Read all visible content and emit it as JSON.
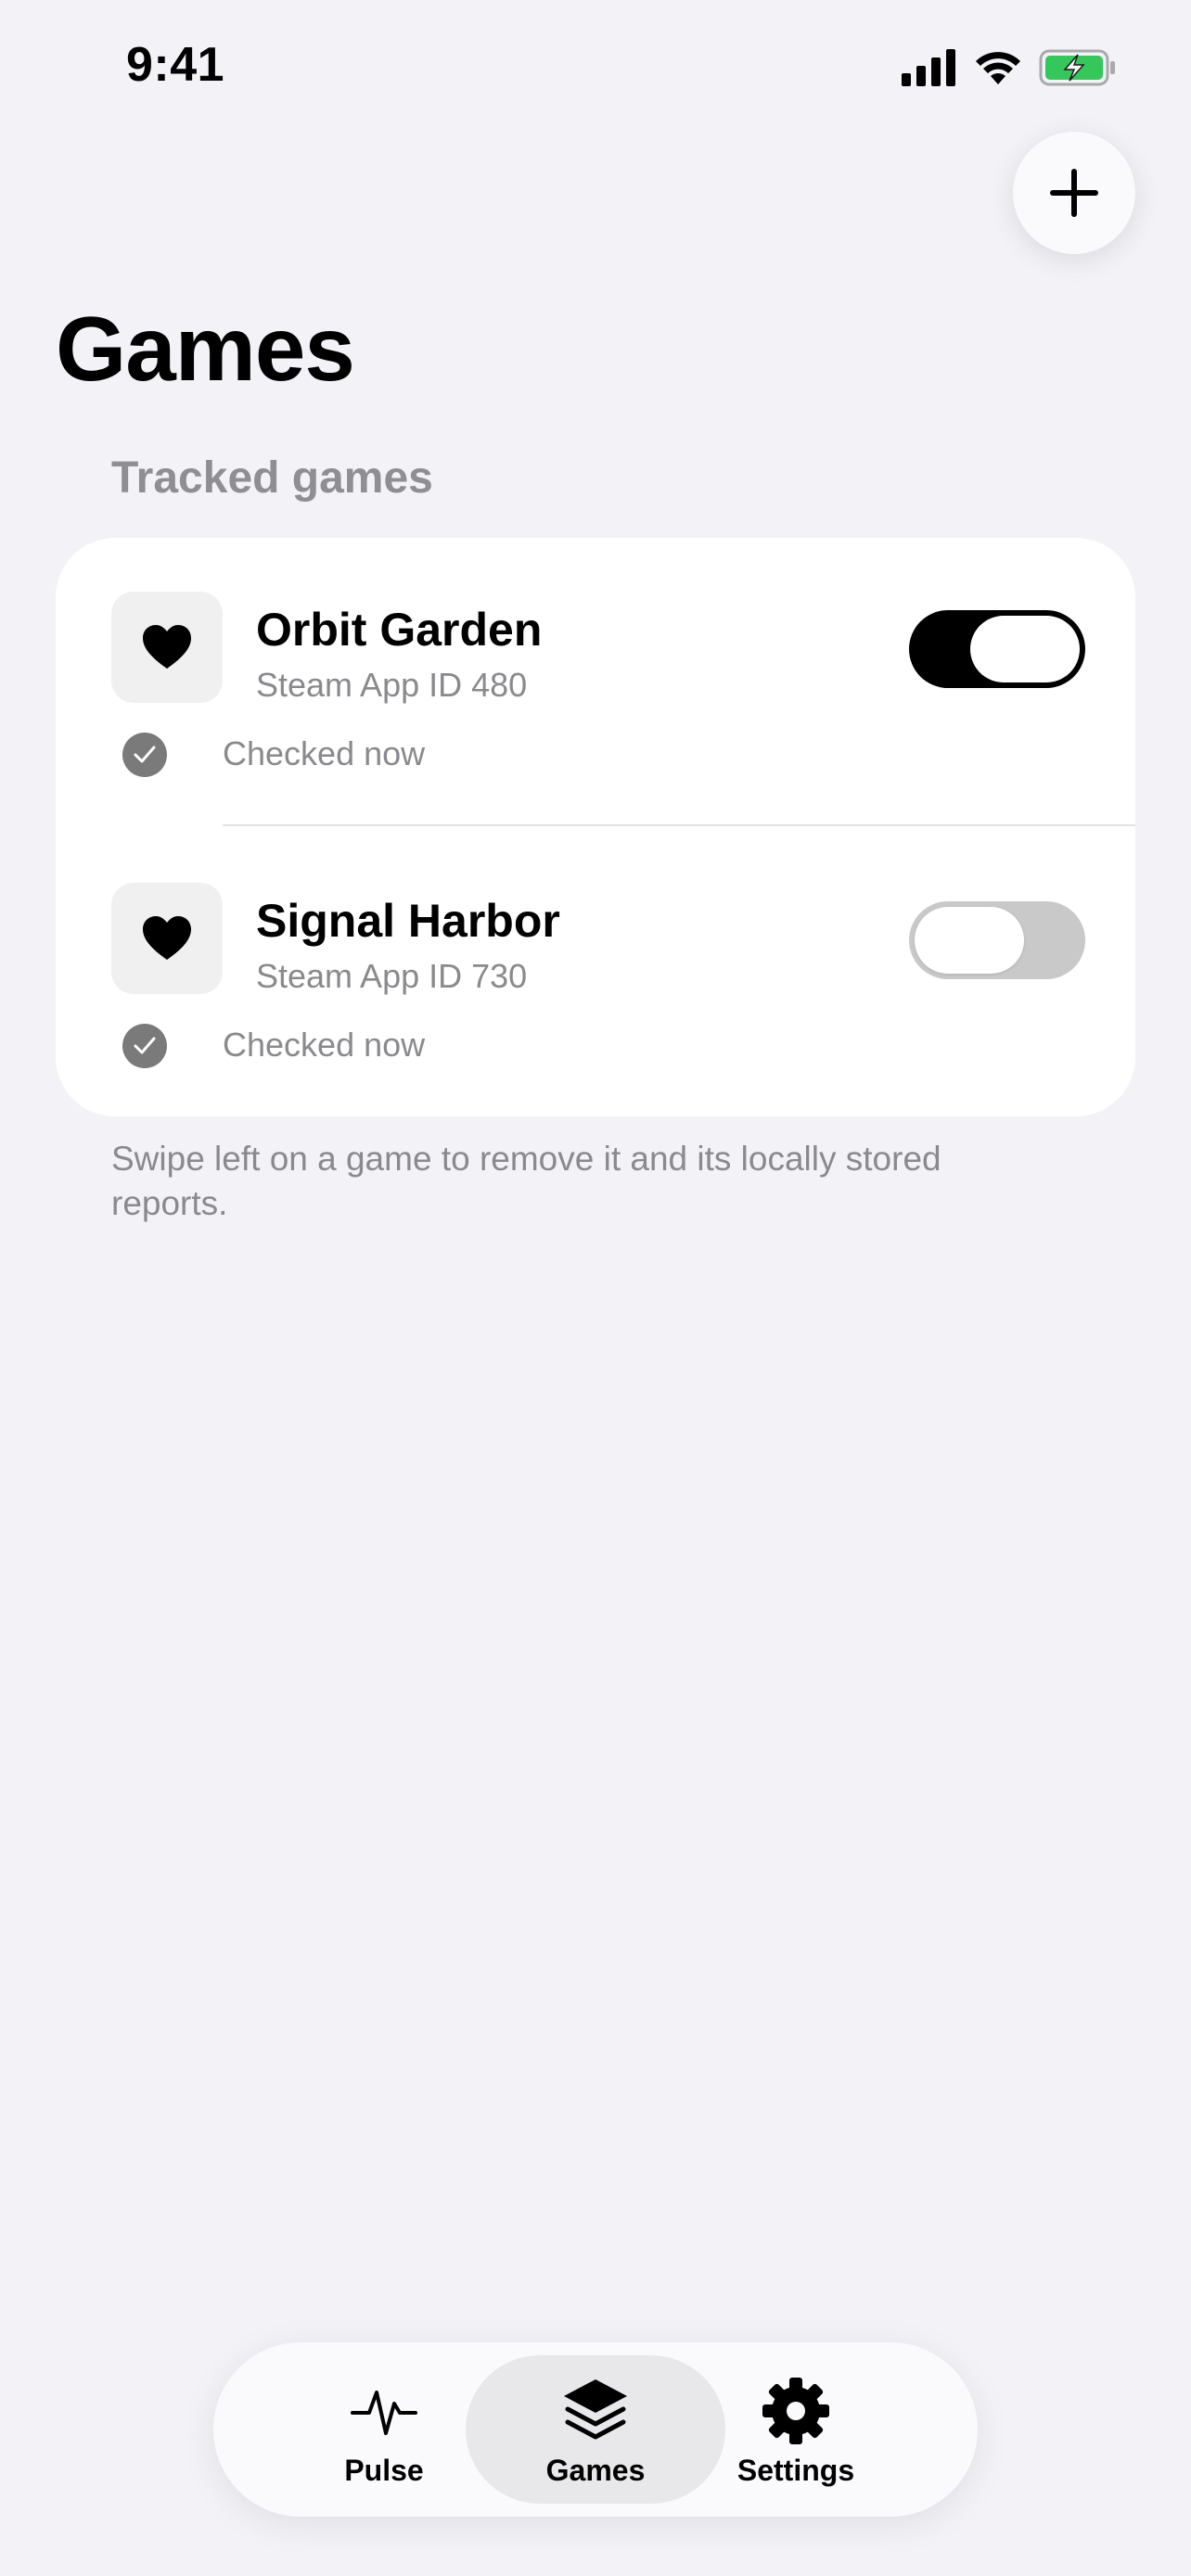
{
  "status_bar": {
    "time": "9:41"
  },
  "header": {
    "title": "Games",
    "add_icon": "plus-icon"
  },
  "tracked": {
    "section_title": "Tracked games",
    "games": [
      {
        "name": "Orbit Garden",
        "subtitle": "Steam App ID 480",
        "status": "Checked now",
        "enabled": true,
        "icon": "heart-icon"
      },
      {
        "name": "Signal Harbor",
        "subtitle": "Steam App ID 730",
        "status": "Checked now",
        "enabled": false,
        "icon": "heart-icon"
      }
    ],
    "footer_note": "Swipe left on a game to remove it and its locally stored reports."
  },
  "tab_bar": {
    "selected": "Games",
    "items": [
      {
        "label": "Pulse",
        "icon": "pulse-icon"
      },
      {
        "label": "Games",
        "icon": "layers-icon"
      },
      {
        "label": "Settings",
        "icon": "gear-icon"
      }
    ]
  },
  "colors": {
    "background": "#f2f2f7",
    "card": "#ffffff",
    "toggle_on": "#000000",
    "toggle_off": "#c9c9c9",
    "secondary_text": "#8a8a8e",
    "battery_green": "#34c759"
  }
}
